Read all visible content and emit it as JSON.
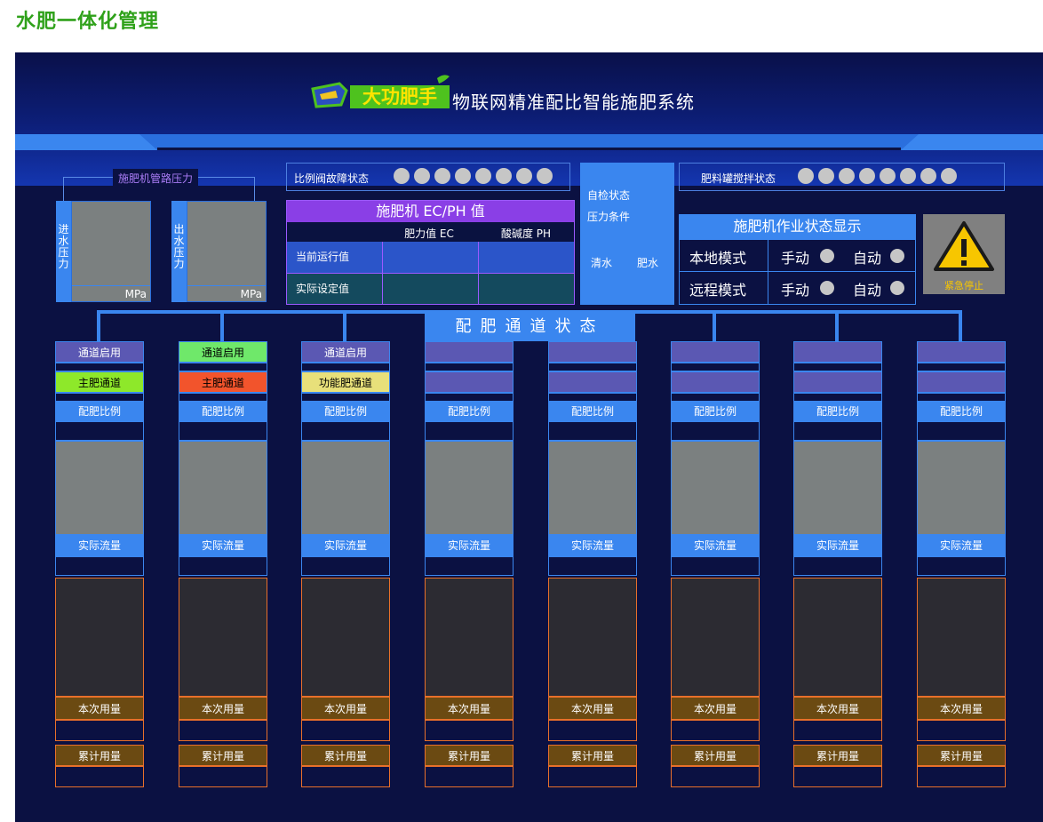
{
  "page_title": "水肥一体化管理",
  "header": {
    "logo_text": "大功肥手",
    "system_title": "物联网精准配比智能施肥系统"
  },
  "pressure": {
    "label": "施肥机管路压力",
    "inlet_label": "进水压力",
    "outlet_label": "出水压力",
    "unit": "MPa"
  },
  "proportional_valve": {
    "label": "比例阀故障状态",
    "indicator_count": 8,
    "indicator_color": "#c6c6c6"
  },
  "ecph": {
    "title": "施肥机 EC/PH 值",
    "col_ec": "肥力值 EC",
    "col_ph": "酸碱度 PH",
    "row_current": "当前运行值",
    "row_setpoint": "实际设定值"
  },
  "self_check": {
    "title_line1": "自检状态",
    "title_line2": "压力条件",
    "clear_water": "清水",
    "fertilizer_water": "肥水"
  },
  "tank_agitation": {
    "label": "肥料罐搅拌状态",
    "indicator_count": 8
  },
  "work_state": {
    "title": "施肥机作业状态显示",
    "local_mode": "本地模式",
    "remote_mode": "远程模式",
    "manual": "手动",
    "auto": "自动"
  },
  "emergency_stop": {
    "label": "紧急停止"
  },
  "channels": {
    "header": "配肥通道状态",
    "ratio_label": "配肥比例",
    "flow_label": "实际流量",
    "current_use_label": "本次用量",
    "total_use_label": "累计用量",
    "items": [
      {
        "enable": "通道启用",
        "enable_color": "#5b58b3",
        "type": "主肥通道",
        "type_color": "#8ee82a"
      },
      {
        "enable": "通道启用",
        "enable_color": "#6fe86a",
        "type": "主肥通道",
        "type_color": "#f2542c"
      },
      {
        "enable": "通道启用",
        "enable_color": "#5b58b3",
        "type": "功能肥通道",
        "type_color": "#e8e07a"
      },
      {
        "enable": "",
        "enable_color": "#5b58b3",
        "type": "",
        "type_color": "#5b58b3"
      },
      {
        "enable": "",
        "enable_color": "#5b58b3",
        "type": "",
        "type_color": "#5b58b3"
      },
      {
        "enable": "",
        "enable_color": "#5b58b3",
        "type": "",
        "type_color": "#5b58b3"
      },
      {
        "enable": "",
        "enable_color": "#5b58b3",
        "type": "",
        "type_color": "#5b58b3"
      },
      {
        "enable": "",
        "enable_color": "#5b58b3",
        "type": "",
        "type_color": "#5b58b3"
      }
    ]
  },
  "colors": {
    "background": "#0b1142",
    "accent_blue": "#3a86ef",
    "purple": "#9b59ff",
    "orange_border": "#e8702a",
    "brown_label": "#6b4a12"
  }
}
